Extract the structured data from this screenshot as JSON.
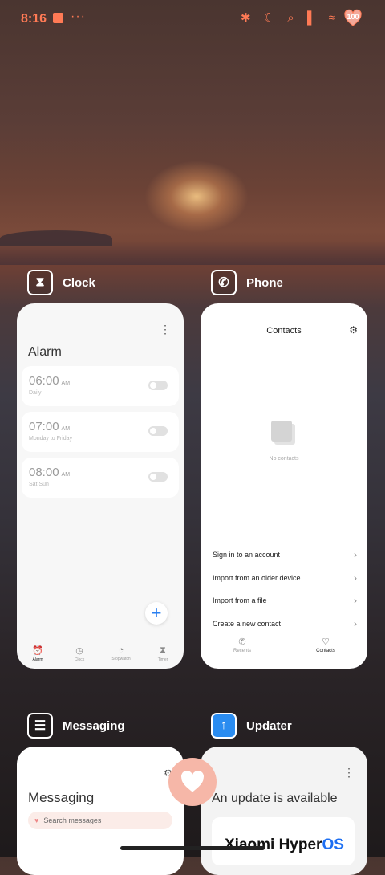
{
  "status_bar": {
    "time": "8:16",
    "dots": "···",
    "icons": "✱ ☾ ⌕ ▌ ≈",
    "battery": "100",
    "accent": "#ff7a55"
  },
  "apps": {
    "clock": {
      "name": "Clock",
      "icon": "hourglass-icon",
      "menu": "⋮",
      "heading": "Alarm",
      "alarms": [
        {
          "time": "06:00",
          "ampm": "AM",
          "repeat": "Daily",
          "enabled": false
        },
        {
          "time": "07:00",
          "ampm": "AM",
          "repeat": "Monday to Friday",
          "enabled": false
        },
        {
          "time": "08:00",
          "ampm": "AM",
          "repeat": "Sat Sun",
          "enabled": false
        }
      ],
      "add": "+",
      "tabs": [
        {
          "label": "Alarm",
          "icon": "alarm-icon",
          "active": true
        },
        {
          "label": "Clock",
          "icon": "clock-icon",
          "active": false
        },
        {
          "label": "Stopwatch",
          "icon": "stopwatch-icon",
          "active": false
        },
        {
          "label": "Timer",
          "icon": "timer-icon",
          "active": false
        }
      ]
    },
    "phone": {
      "name": "Phone",
      "icon": "phone-icon",
      "title": "Contacts",
      "empty_text": "No contacts",
      "actions": [
        "Sign in to an account",
        "Import from an older device",
        "Import from a file",
        "Create a new contact"
      ],
      "tabs": [
        {
          "label": "Recents",
          "icon": "recents-icon",
          "active": false
        },
        {
          "label": "Contacts",
          "icon": "contacts-icon",
          "active": true
        }
      ]
    },
    "messaging": {
      "name": "Messaging",
      "icon": "chat-icon",
      "title": "Messaging",
      "search_placeholder": "Search messages"
    },
    "updater": {
      "name": "Updater",
      "icon": "update-icon",
      "menu": "⋮",
      "title": "An update is available",
      "brand_main": "Xiaomi Hyper",
      "brand_os": "OS"
    }
  }
}
